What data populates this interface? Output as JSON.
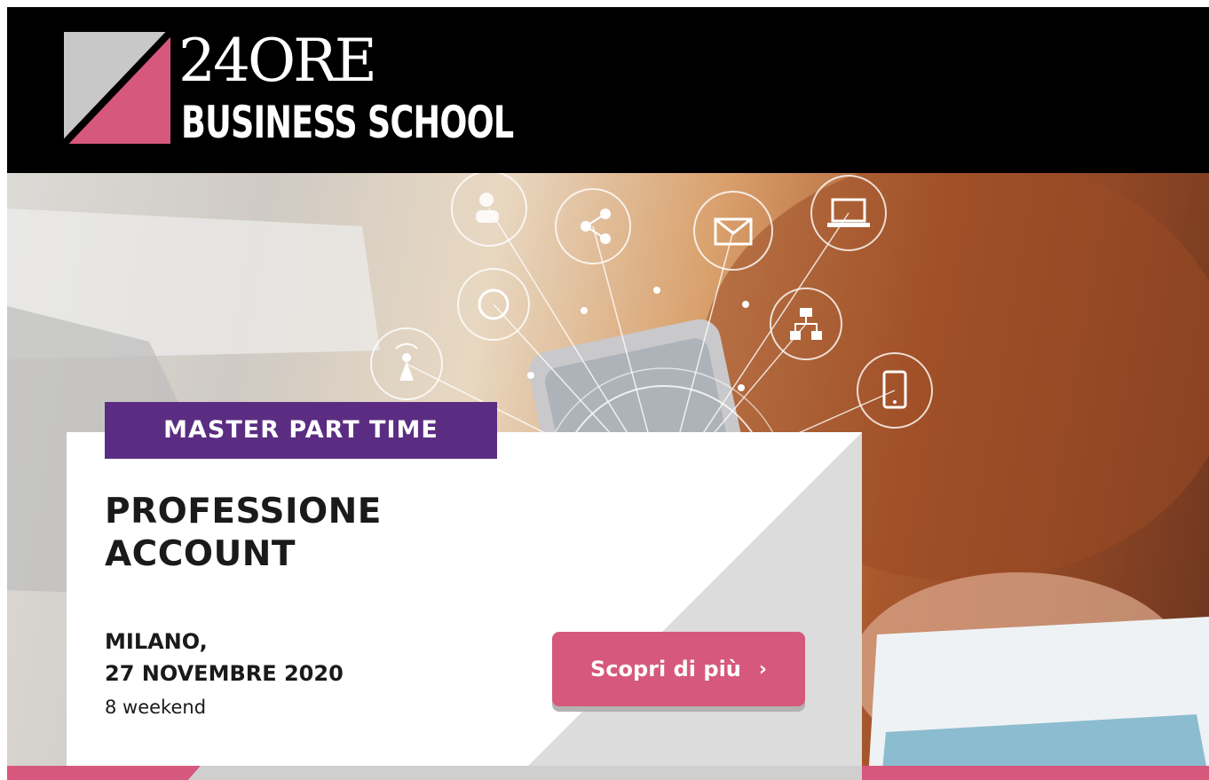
{
  "header": {
    "logo_line1": "24ORE",
    "logo_line2": "BUSINESS SCHOOL",
    "logo_icon": "24ore-square-triangle-logo"
  },
  "promo": {
    "badge": "MASTER PART TIME",
    "title": "PROFESSIONE ACCOUNT",
    "city": "MILANO,",
    "date": "27 NOVEMBRE 2020",
    "duration": "8 weekend",
    "cta_label": "Scopri di più",
    "cta_icon": "chevron-right-icon"
  },
  "hero_icons": [
    "people-icon",
    "share-icon",
    "mail-icon",
    "laptop-icon",
    "refresh-icon",
    "network-icon",
    "wifi-tower-icon",
    "smartphone-icon"
  ],
  "colors": {
    "header_bg": "#000000",
    "badge_bg": "#5b2d82",
    "accent_pink": "#d6587d",
    "logo_gray": "#c8c8c8",
    "card_gray": "#dcdcdc"
  }
}
